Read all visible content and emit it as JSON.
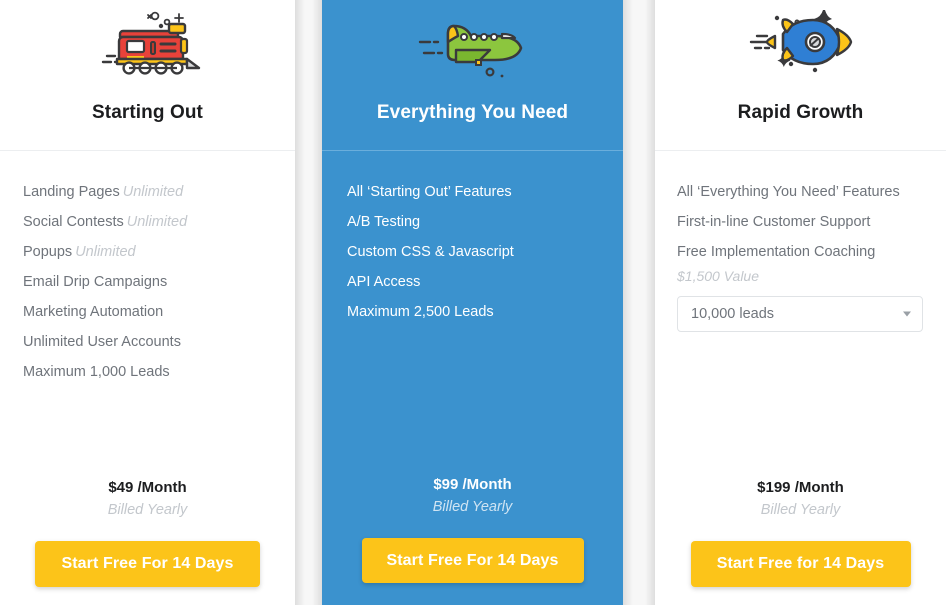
{
  "theme": {
    "featured_background": "#3b92ce",
    "cta_background": "#fcc419",
    "cta_text_color": "#ffffff",
    "heading_color": "#1c1d1f",
    "feature_text_color": "#6f747b",
    "muted_text_color": "#c3c7cc"
  },
  "plans": [
    {
      "id": "starting-out",
      "icon": "train-icon",
      "title": "Starting Out",
      "featured": false,
      "features": [
        {
          "label": "Landing Pages",
          "value": "Unlimited"
        },
        {
          "label": "Social Contests",
          "value": "Unlimited"
        },
        {
          "label": "Popups",
          "value": "Unlimited"
        },
        {
          "label": "Email Drip Campaigns",
          "value": ""
        },
        {
          "label": "Marketing Automation",
          "value": ""
        },
        {
          "label": "Unlimited User Accounts",
          "value": ""
        },
        {
          "label": "Maximum 1,000 Leads",
          "value": ""
        }
      ],
      "price": "$49",
      "price_period": "/Month",
      "billing_note": "Billed Yearly",
      "cta_label": "Start Free For 14 Days"
    },
    {
      "id": "everything-you-need",
      "icon": "airplane-icon",
      "title": "Everything You Need",
      "featured": true,
      "features": [
        {
          "label": "All ‘Starting Out’ Features",
          "value": ""
        },
        {
          "label": "A/B Testing",
          "value": ""
        },
        {
          "label": "Custom CSS & Javascript",
          "value": ""
        },
        {
          "label": "API Access",
          "value": ""
        },
        {
          "label": "Maximum 2,500 Leads",
          "value": ""
        }
      ],
      "price": "$99",
      "price_period": "/Month",
      "billing_note": "Billed Yearly",
      "cta_label": "Start Free For 14 Days"
    },
    {
      "id": "rapid-growth",
      "icon": "rocket-icon",
      "title": "Rapid Growth",
      "featured": false,
      "features": [
        {
          "label": "All ‘Everything You Need’ Features",
          "value": ""
        },
        {
          "label": "First-in-line Customer Support",
          "value": ""
        },
        {
          "label": "Free Implementation Coaching",
          "value": "",
          "sub": "$1,500 Value"
        }
      ],
      "lead_select": {
        "selected": "10,000 leads",
        "options": [
          "10,000 leads"
        ],
        "arrow_icon": "chevron-down-icon"
      },
      "price": "$199",
      "price_period": "/Month",
      "billing_note": "Billed Yearly",
      "cta_label": "Start Free for 14 Days"
    }
  ]
}
